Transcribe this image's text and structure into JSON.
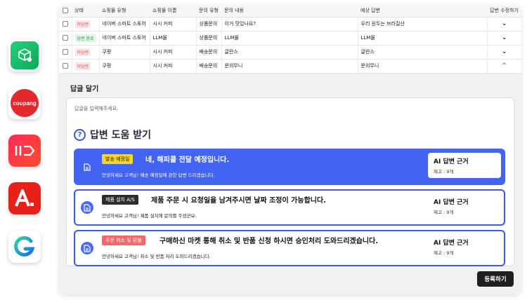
{
  "apps": [
    {
      "name": "smartstore",
      "icon": "smartstore-icon"
    },
    {
      "name": "coupang",
      "label": "coupang"
    },
    {
      "name": "11st",
      "label": "11"
    },
    {
      "name": "auction",
      "label": "A."
    },
    {
      "name": "gmarket",
      "label": "G"
    }
  ],
  "table": {
    "headers": [
      "상태",
      "쇼핑몰 유형",
      "쇼핑몰 이름",
      "문의 유형",
      "문의 내용",
      "예상 답변",
      "답변 수정하기"
    ],
    "rows": [
      {
        "status": "미답변",
        "status_type": "pending",
        "mall_type": "네이버 스마트 스토어",
        "mall_name": "시시 커피",
        "inquiry_type": "상품문의",
        "content": "이거 맛있나요?",
        "expected": "우리 원두는 브라질산",
        "toggle": "down"
      },
      {
        "status": "답변 완료",
        "status_type": "done",
        "mall_type": "네이버 스마트 스토어",
        "mall_name": "LLM몰",
        "inquiry_type": "상품문의",
        "content": "LLM몰",
        "expected": "LLM몰",
        "toggle": "down"
      },
      {
        "status": "미답변",
        "status_type": "pending",
        "mall_type": "쿠팡",
        "mall_name": "시시 커피",
        "inquiry_type": "배송문의",
        "content": "글란스",
        "expected": "글란스",
        "toggle": "down"
      },
      {
        "status": "미답변",
        "status_type": "pending",
        "mall_type": "쿠팡",
        "mall_name": "시시 커피",
        "inquiry_type": "배송문의",
        "content": "문의무니",
        "expected": "문의무니",
        "toggle": "up"
      }
    ]
  },
  "reply": {
    "title": "답글 달기",
    "placeholder": "답글을 입력해주세요.",
    "help_title": "답변 도움 받기",
    "cards": [
      {
        "tag": "발송 예정일",
        "tag_style": "yellow",
        "headline": "네, 해피콜 전달 예정입니다.",
        "body": "안녕하세요 고객님! 배송 예정일에 관한 답변 드리겠습니다.",
        "basis_title": "AI 답변 근거",
        "basis_stock": "재고 : 9개",
        "active": true
      },
      {
        "tag": "제품 설치 A/S",
        "tag_style": "dark",
        "headline": "제품 주문 시 요청일을 남겨주시면 날짜 조정이 가능합니다.",
        "body": "안녕하세요 고객님! 제품 설치에 문의를 주셨군요.",
        "basis_title": "AI 답변 근거",
        "basis_stock": "재고 : 9개",
        "active": false
      },
      {
        "tag": "주문 취소 및 환불",
        "tag_style": "red",
        "headline": "구매하신 마켓 통해 취소 및 반품 신청 하시면 승인처리 도와드리겠습니다.",
        "body": "안녕하세요 고객님! 취소 및 반품 처리 도와드리겠습니다.",
        "basis_title": "AI 답변 근거",
        "basis_stock": "재고 : 9개",
        "active": false
      }
    ],
    "submit_label": "등록하기"
  }
}
